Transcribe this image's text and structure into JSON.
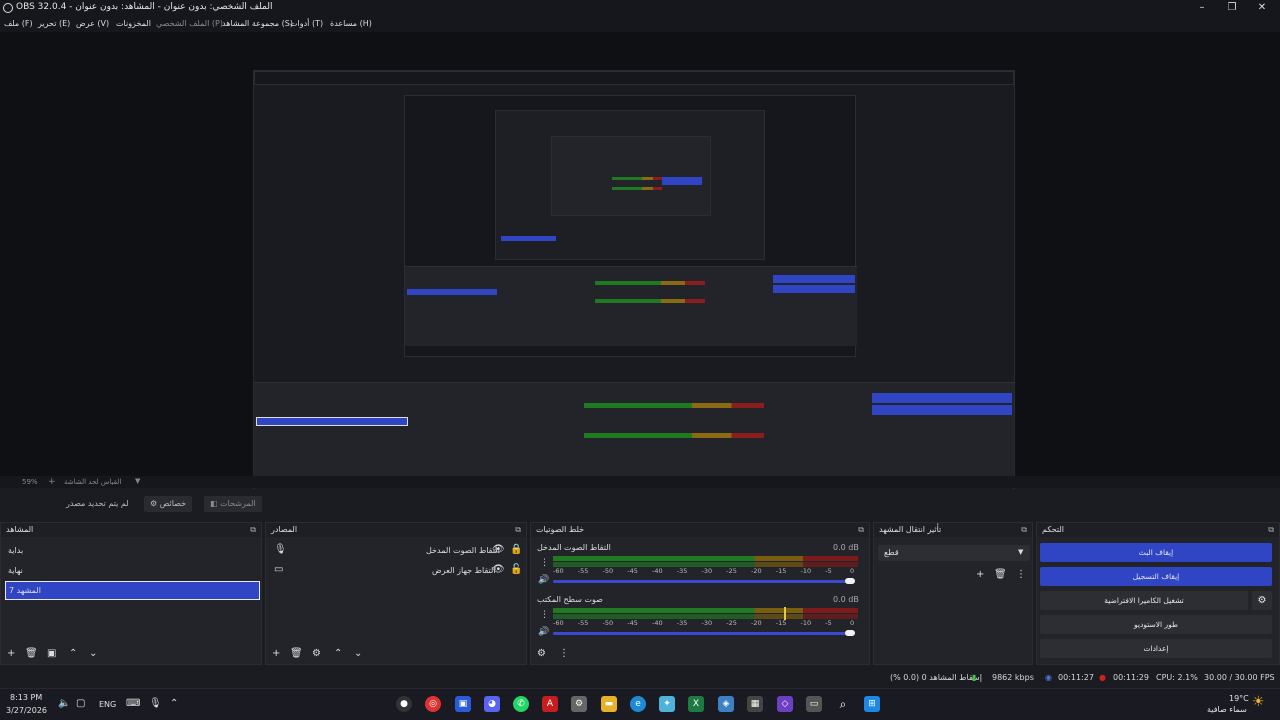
{
  "window": {
    "title": "OBS 32.0.4 - الملف الشخصي: بدون عنوان - المشاهد: بدون عنوان",
    "minimize": "–",
    "restore": "❐",
    "close": "✕"
  },
  "menu": {
    "file": "ملف (F)",
    "edit": "تحرير (E)",
    "view": "عرض (V)",
    "docks": "المخزونات",
    "profile": "الملف الشخصي (P)",
    "scene_collection": "مجموعة المشاهد (S)",
    "tools": "أدوات (T)",
    "help": "مساعدة (H)"
  },
  "zoom": {
    "level": "59%",
    "add": "+",
    "scale_label": "القياس لحد الشاشة"
  },
  "source_toolbar": {
    "no_source": "لم يتم تحديد مصدر",
    "properties": "خصائص",
    "filters": "المرشحات"
  },
  "scenes": {
    "title": "المشاهد",
    "items": [
      "بداية",
      "نهاية",
      "المشهد 7"
    ],
    "selected_index": 2
  },
  "sources": {
    "title": "المصادر",
    "items": [
      {
        "label": "التقاط الصوت المدخل",
        "icon": "microphone-icon"
      },
      {
        "label": "التقاط جهاز العرض",
        "icon": "monitor-icon"
      }
    ]
  },
  "mixer": {
    "title": "خلط الصوتيات",
    "channels": [
      {
        "name": "التقاط الصوت المدخل",
        "db": "0.0 dB",
        "level": 0.58,
        "volume": 1.0
      },
      {
        "name": "صوت سطح المكتب",
        "db": "0.0 dB",
        "level": 0.74,
        "volume": 1.0
      }
    ],
    "ticks": [
      "-60",
      "-55",
      "-50",
      "-45",
      "-40",
      "-35",
      "-30",
      "-25",
      "-20",
      "-15",
      "-10",
      "-5",
      "0"
    ]
  },
  "transitions": {
    "title": "تأثير انتقال المشهد",
    "selected": "قطع"
  },
  "controls": {
    "title": "التحكم",
    "stop_stream": "إيقاف البث",
    "stop_record": "إيقاف التسجيل",
    "virtual_camera": "تشغيل الكاميرا الافتراضية",
    "studio_mode": "طور الاستوديو",
    "settings": "إعدادات"
  },
  "status": {
    "dropped": "إسقاط المشاهد 0 (0.0 %)",
    "bitrate": "9862 kbps",
    "stream_time": "00:11:27",
    "record_time": "00:11:29",
    "cpu": "CPU: 2.1%",
    "fps": "30.00 / 30.00 FPS"
  },
  "taskbar": {
    "time": "8:13 PM",
    "date": "3/27/2026",
    "lang": "ENG",
    "weather_temp": "19°C",
    "weather_desc": "سماء صافية",
    "apps": [
      "obs",
      "chrome",
      "store",
      "discord",
      "whatsapp",
      "acrobat",
      "settings",
      "files",
      "edge",
      "copilot",
      "excel",
      "photos",
      "calc",
      "vscode",
      "snip",
      "search",
      "start"
    ]
  },
  "colors": {
    "accent": "#2f45c4",
    "background": "#1b1c22",
    "panel": "#23242a",
    "meter_green": "#1f7a22",
    "meter_yellow": "#7a5e10",
    "meter_red": "#7d1a1a",
    "record": "#d02020"
  }
}
